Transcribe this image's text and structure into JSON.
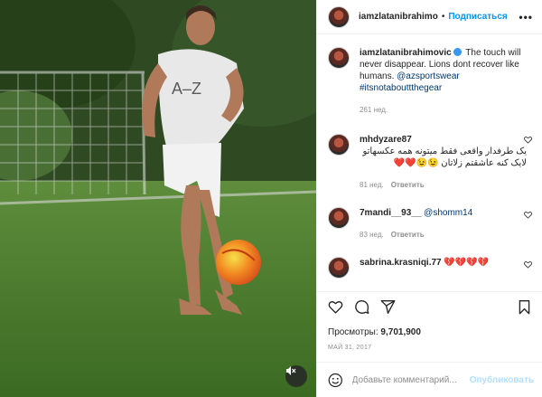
{
  "header": {
    "username": "iamzlatanibrahimo",
    "separator": "•",
    "follow_label": "Подписаться",
    "more_label": "•••"
  },
  "media": {
    "shirt_text": "A–Z",
    "mute_icon": "speaker-muted-icon"
  },
  "caption": {
    "username": "iamzlatanibrahimovic",
    "text": " The touch will never disappear. Lions dont recover like humans. ",
    "mention": "@azsportswear",
    "hashtag": "#itsnotabouttthegear",
    "time": "261 нед."
  },
  "comments": [
    {
      "username": "mhdyzare87",
      "text": "یک طرفدار واقعی فقط میتونه همه عکسهاتو لایک کنه عاشقتم زلاتان 😉😉❤️❤️",
      "time": "81 нед.",
      "reply_label": "Ответить"
    },
    {
      "username": "7mandi__93__",
      "text": "@shomm14",
      "time": "83 нед.",
      "reply_label": "Ответить"
    },
    {
      "username": "sabrina.krasniqi.77",
      "text": "💔💔💔💔",
      "time": "",
      "reply_label": ""
    }
  ],
  "actions": {
    "like_icon": "heart-icon",
    "comment_icon": "comment-icon",
    "share_icon": "paper-plane-icon",
    "save_icon": "bookmark-icon"
  },
  "views": {
    "label": "Просмотры:",
    "value": "9,701,900"
  },
  "date": "МАЙ 31, 2017",
  "add_comment": {
    "placeholder": "Добавьте комментарий...",
    "publish_label": "Опубликовать"
  },
  "colors": {
    "accent": "#0095f6",
    "link": "#00376b",
    "muted": "#8e8e8e",
    "heart": "#e0245e"
  }
}
